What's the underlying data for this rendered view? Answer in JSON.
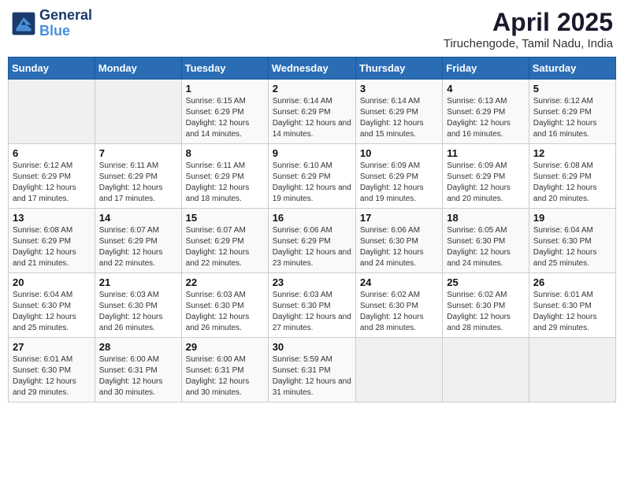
{
  "logo": {
    "line1": "General",
    "line2": "Blue"
  },
  "title": "April 2025",
  "location": "Tiruchengode, Tamil Nadu, India",
  "weekdays": [
    "Sunday",
    "Monday",
    "Tuesday",
    "Wednesday",
    "Thursday",
    "Friday",
    "Saturday"
  ],
  "weeks": [
    [
      {
        "day": "",
        "info": ""
      },
      {
        "day": "",
        "info": ""
      },
      {
        "day": "1",
        "info": "Sunrise: 6:15 AM\nSunset: 6:29 PM\nDaylight: 12 hours and 14 minutes."
      },
      {
        "day": "2",
        "info": "Sunrise: 6:14 AM\nSunset: 6:29 PM\nDaylight: 12 hours and 14 minutes."
      },
      {
        "day": "3",
        "info": "Sunrise: 6:14 AM\nSunset: 6:29 PM\nDaylight: 12 hours and 15 minutes."
      },
      {
        "day": "4",
        "info": "Sunrise: 6:13 AM\nSunset: 6:29 PM\nDaylight: 12 hours and 16 minutes."
      },
      {
        "day": "5",
        "info": "Sunrise: 6:12 AM\nSunset: 6:29 PM\nDaylight: 12 hours and 16 minutes."
      }
    ],
    [
      {
        "day": "6",
        "info": "Sunrise: 6:12 AM\nSunset: 6:29 PM\nDaylight: 12 hours and 17 minutes."
      },
      {
        "day": "7",
        "info": "Sunrise: 6:11 AM\nSunset: 6:29 PM\nDaylight: 12 hours and 17 minutes."
      },
      {
        "day": "8",
        "info": "Sunrise: 6:11 AM\nSunset: 6:29 PM\nDaylight: 12 hours and 18 minutes."
      },
      {
        "day": "9",
        "info": "Sunrise: 6:10 AM\nSunset: 6:29 PM\nDaylight: 12 hours and 19 minutes."
      },
      {
        "day": "10",
        "info": "Sunrise: 6:09 AM\nSunset: 6:29 PM\nDaylight: 12 hours and 19 minutes."
      },
      {
        "day": "11",
        "info": "Sunrise: 6:09 AM\nSunset: 6:29 PM\nDaylight: 12 hours and 20 minutes."
      },
      {
        "day": "12",
        "info": "Sunrise: 6:08 AM\nSunset: 6:29 PM\nDaylight: 12 hours and 20 minutes."
      }
    ],
    [
      {
        "day": "13",
        "info": "Sunrise: 6:08 AM\nSunset: 6:29 PM\nDaylight: 12 hours and 21 minutes."
      },
      {
        "day": "14",
        "info": "Sunrise: 6:07 AM\nSunset: 6:29 PM\nDaylight: 12 hours and 22 minutes."
      },
      {
        "day": "15",
        "info": "Sunrise: 6:07 AM\nSunset: 6:29 PM\nDaylight: 12 hours and 22 minutes."
      },
      {
        "day": "16",
        "info": "Sunrise: 6:06 AM\nSunset: 6:29 PM\nDaylight: 12 hours and 23 minutes."
      },
      {
        "day": "17",
        "info": "Sunrise: 6:06 AM\nSunset: 6:30 PM\nDaylight: 12 hours and 24 minutes."
      },
      {
        "day": "18",
        "info": "Sunrise: 6:05 AM\nSunset: 6:30 PM\nDaylight: 12 hours and 24 minutes."
      },
      {
        "day": "19",
        "info": "Sunrise: 6:04 AM\nSunset: 6:30 PM\nDaylight: 12 hours and 25 minutes."
      }
    ],
    [
      {
        "day": "20",
        "info": "Sunrise: 6:04 AM\nSunset: 6:30 PM\nDaylight: 12 hours and 25 minutes."
      },
      {
        "day": "21",
        "info": "Sunrise: 6:03 AM\nSunset: 6:30 PM\nDaylight: 12 hours and 26 minutes."
      },
      {
        "day": "22",
        "info": "Sunrise: 6:03 AM\nSunset: 6:30 PM\nDaylight: 12 hours and 26 minutes."
      },
      {
        "day": "23",
        "info": "Sunrise: 6:03 AM\nSunset: 6:30 PM\nDaylight: 12 hours and 27 minutes."
      },
      {
        "day": "24",
        "info": "Sunrise: 6:02 AM\nSunset: 6:30 PM\nDaylight: 12 hours and 28 minutes."
      },
      {
        "day": "25",
        "info": "Sunrise: 6:02 AM\nSunset: 6:30 PM\nDaylight: 12 hours and 28 minutes."
      },
      {
        "day": "26",
        "info": "Sunrise: 6:01 AM\nSunset: 6:30 PM\nDaylight: 12 hours and 29 minutes."
      }
    ],
    [
      {
        "day": "27",
        "info": "Sunrise: 6:01 AM\nSunset: 6:30 PM\nDaylight: 12 hours and 29 minutes."
      },
      {
        "day": "28",
        "info": "Sunrise: 6:00 AM\nSunset: 6:31 PM\nDaylight: 12 hours and 30 minutes."
      },
      {
        "day": "29",
        "info": "Sunrise: 6:00 AM\nSunset: 6:31 PM\nDaylight: 12 hours and 30 minutes."
      },
      {
        "day": "30",
        "info": "Sunrise: 5:59 AM\nSunset: 6:31 PM\nDaylight: 12 hours and 31 minutes."
      },
      {
        "day": "",
        "info": ""
      },
      {
        "day": "",
        "info": ""
      },
      {
        "day": "",
        "info": ""
      }
    ]
  ]
}
